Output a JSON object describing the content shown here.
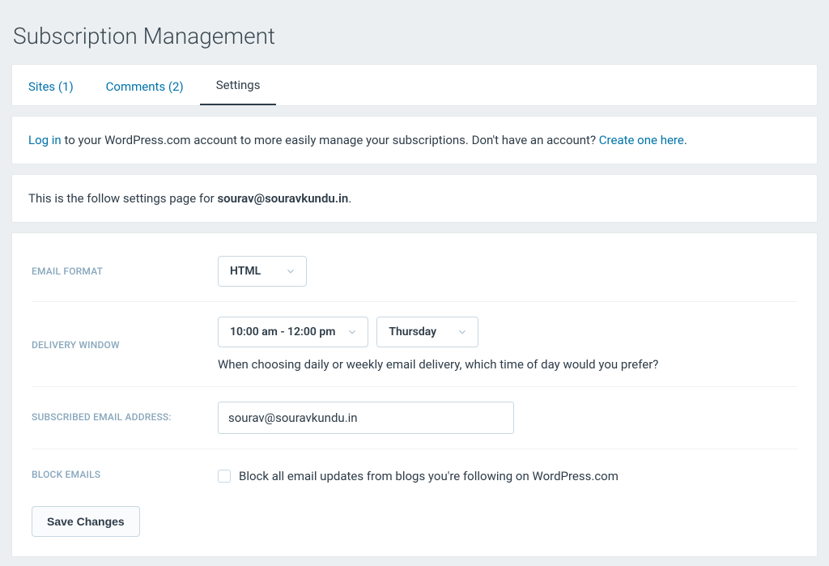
{
  "page_title": "Subscription Management",
  "tabs": {
    "sites": "Sites (1)",
    "comments": "Comments (2)",
    "settings": "Settings"
  },
  "login_notice": {
    "login_link": "Log in",
    "text_mid": " to your WordPress.com account to more easily manage your subscriptions. Don't have an account? ",
    "create_link": "Create one here",
    "period": "."
  },
  "follow_settings_notice": {
    "prefix": "This is the follow settings page for ",
    "email": "sourav@souravkundu.in",
    "suffix": "."
  },
  "settings": {
    "email_format": {
      "label": "EMAIL FORMAT",
      "value": "HTML"
    },
    "delivery_window": {
      "label": "DELIVERY WINDOW",
      "time_value": "10:00 am - 12:00 pm",
      "day_value": "Thursday",
      "helper": "When choosing daily or weekly email delivery, which time of day would you prefer?"
    },
    "subscribed_email": {
      "label": "SUBSCRIBED EMAIL ADDRESS:",
      "value": "sourav@souravkundu.in"
    },
    "block_emails": {
      "label": "BLOCK EMAILS",
      "checkbox_label": "Block all email updates from blogs you're following on WordPress.com",
      "checked": false
    },
    "save_button": "Save Changes"
  }
}
